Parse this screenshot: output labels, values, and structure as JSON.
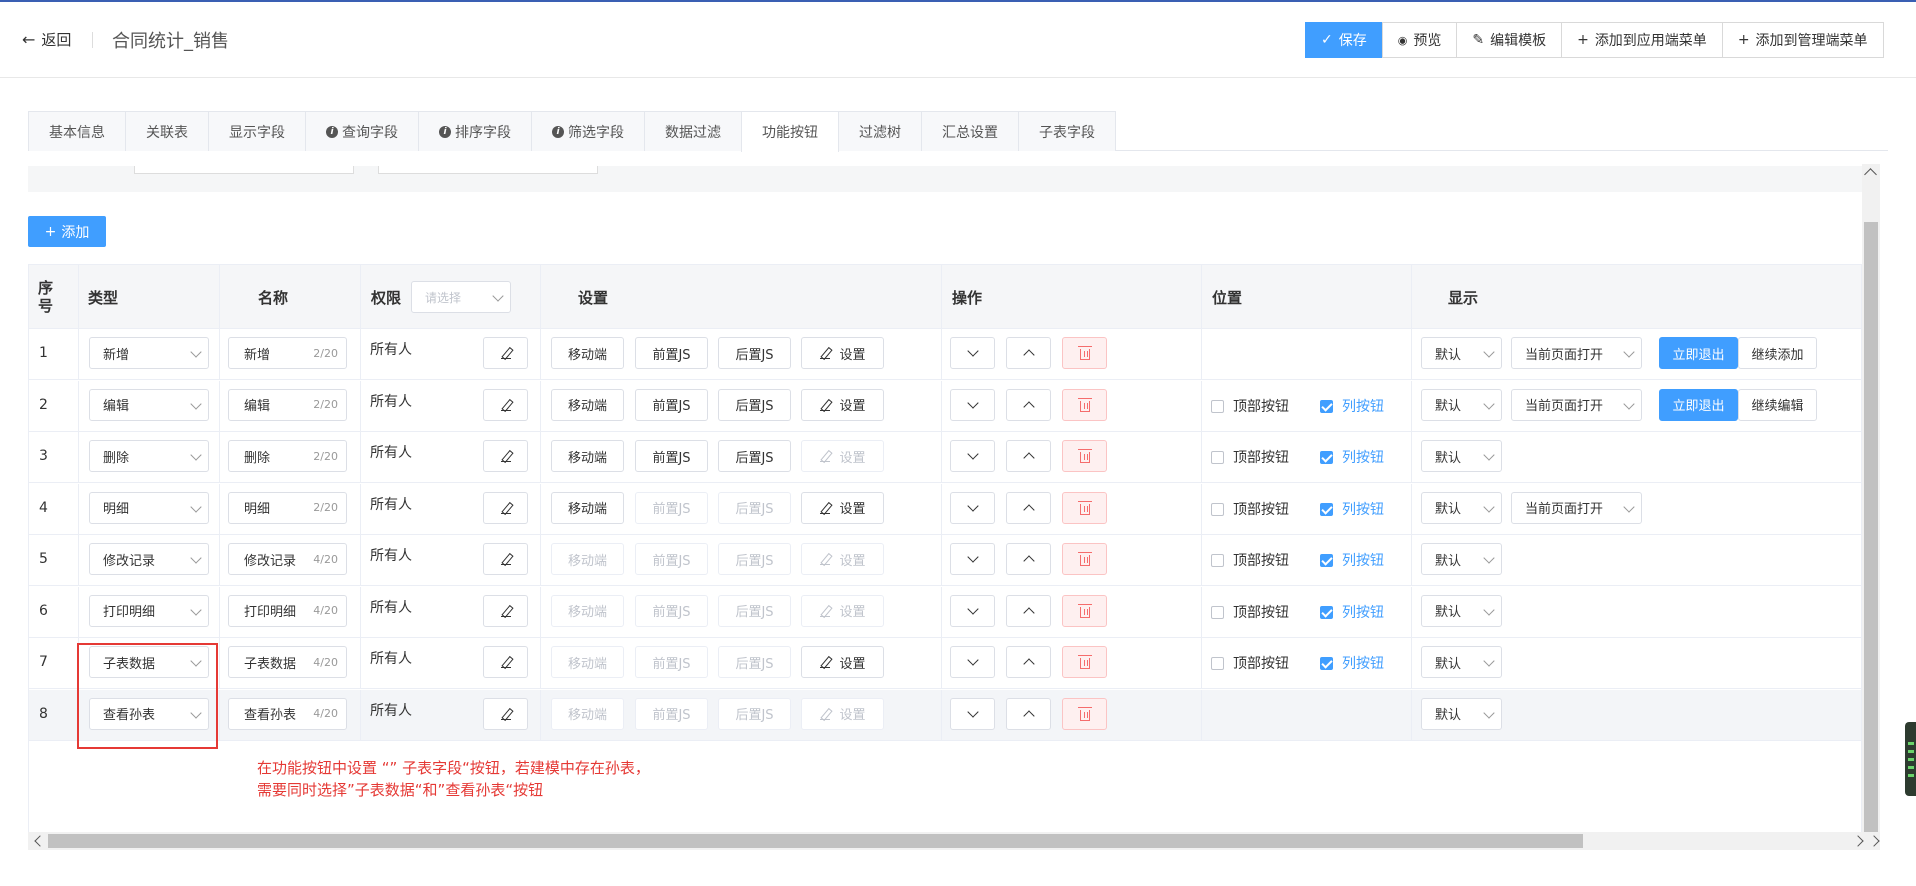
{
  "header": {
    "back_label": "返回",
    "title": "合同统计_销售",
    "actions": [
      {
        "label": "保存",
        "icon": "check-icon",
        "primary": true
      },
      {
        "label": "预览",
        "icon": "eye-icon"
      },
      {
        "label": "编辑模板",
        "icon": "pen-icon"
      },
      {
        "label": "添加到应用端菜单",
        "icon": "plus-icon"
      },
      {
        "label": "添加到管理端菜单",
        "icon": "plus-icon"
      }
    ]
  },
  "tabs": [
    {
      "label": "基本信息",
      "info": false
    },
    {
      "label": "关联表",
      "info": false
    },
    {
      "label": "显示字段",
      "info": false
    },
    {
      "label": "查询字段",
      "info": true
    },
    {
      "label": "排序字段",
      "info": true
    },
    {
      "label": "筛选字段",
      "info": true
    },
    {
      "label": "数据过滤",
      "info": false
    },
    {
      "label": "功能按钮",
      "info": false,
      "active": true
    },
    {
      "label": "过滤树",
      "info": false
    },
    {
      "label": "汇总设置",
      "info": false
    },
    {
      "label": "子表字段",
      "info": false
    }
  ],
  "add_button": "添加",
  "table": {
    "headers": {
      "index": "序号",
      "type": "类型",
      "name": "名称",
      "permission": "权限",
      "permission_placeholder": "请选择",
      "settings": "设置",
      "operation": "操作",
      "position": "位置",
      "display": "显示"
    },
    "labels": {
      "mobile": "移动端",
      "pre_js": "前置JS",
      "post_js": "后置JS",
      "settings": "设置",
      "top_button": "顶部按钮",
      "column_button": "列按钮"
    },
    "rows": [
      {
        "index": "1",
        "type": "新增",
        "name": "新增",
        "count": "2/20",
        "perm": "所有人",
        "mobile": true,
        "pre": true,
        "post": true,
        "set": true,
        "pos": false,
        "top": false,
        "col": false,
        "display": "默认",
        "open": "当前页面打开",
        "b1": "立即退出",
        "b2": "继续添加"
      },
      {
        "index": "2",
        "type": "编辑",
        "name": "编辑",
        "count": "2/20",
        "perm": "所有人",
        "mobile": true,
        "pre": true,
        "post": true,
        "set": true,
        "pos": true,
        "top": false,
        "col": true,
        "display": "默认",
        "open": "当前页面打开",
        "b1": "立即退出",
        "b2": "继续编辑"
      },
      {
        "index": "3",
        "type": "删除",
        "name": "删除",
        "count": "2/20",
        "perm": "所有人",
        "mobile": true,
        "pre": true,
        "post": true,
        "set": false,
        "pos": true,
        "top": false,
        "col": true,
        "display": "默认",
        "open": "",
        "b1": "",
        "b2": ""
      },
      {
        "index": "4",
        "type": "明细",
        "name": "明细",
        "count": "2/20",
        "perm": "所有人",
        "mobile": true,
        "pre": false,
        "post": false,
        "set": true,
        "pos": true,
        "top": false,
        "col": true,
        "display": "默认",
        "open": "当前页面打开",
        "b1": "",
        "b2": ""
      },
      {
        "index": "5",
        "type": "修改记录",
        "name": "修改记录",
        "count": "4/20",
        "perm": "所有人",
        "mobile": false,
        "pre": false,
        "post": false,
        "set": false,
        "pos": true,
        "top": false,
        "col": true,
        "display": "默认",
        "open": "",
        "b1": "",
        "b2": ""
      },
      {
        "index": "6",
        "type": "打印明细",
        "name": "打印明细",
        "count": "4/20",
        "perm": "所有人",
        "mobile": false,
        "pre": false,
        "post": false,
        "set": false,
        "pos": true,
        "top": false,
        "col": true,
        "display": "默认",
        "open": "",
        "b1": "",
        "b2": ""
      },
      {
        "index": "7",
        "type": "子表数据",
        "name": "子表数据",
        "count": "4/20",
        "perm": "所有人",
        "mobile": false,
        "pre": false,
        "post": false,
        "set": true,
        "pos": true,
        "top": false,
        "col": true,
        "display": "默认",
        "open": "",
        "b1": "",
        "b2": ""
      },
      {
        "index": "8",
        "type": "查看孙表",
        "name": "查看孙表",
        "count": "4/20",
        "perm": "所有人",
        "mobile": false,
        "pre": false,
        "post": false,
        "set": false,
        "pos": false,
        "top": false,
        "col": false,
        "display": "默认",
        "open": "",
        "b1": "",
        "b2": ""
      }
    ]
  },
  "annotation": {
    "line1": "在功能按钮中设置 “” 子表字段“按钮，若建模中存在孙表，",
    "line2": "需要同时选择”子表数据“和”查看孙表“按钮"
  }
}
